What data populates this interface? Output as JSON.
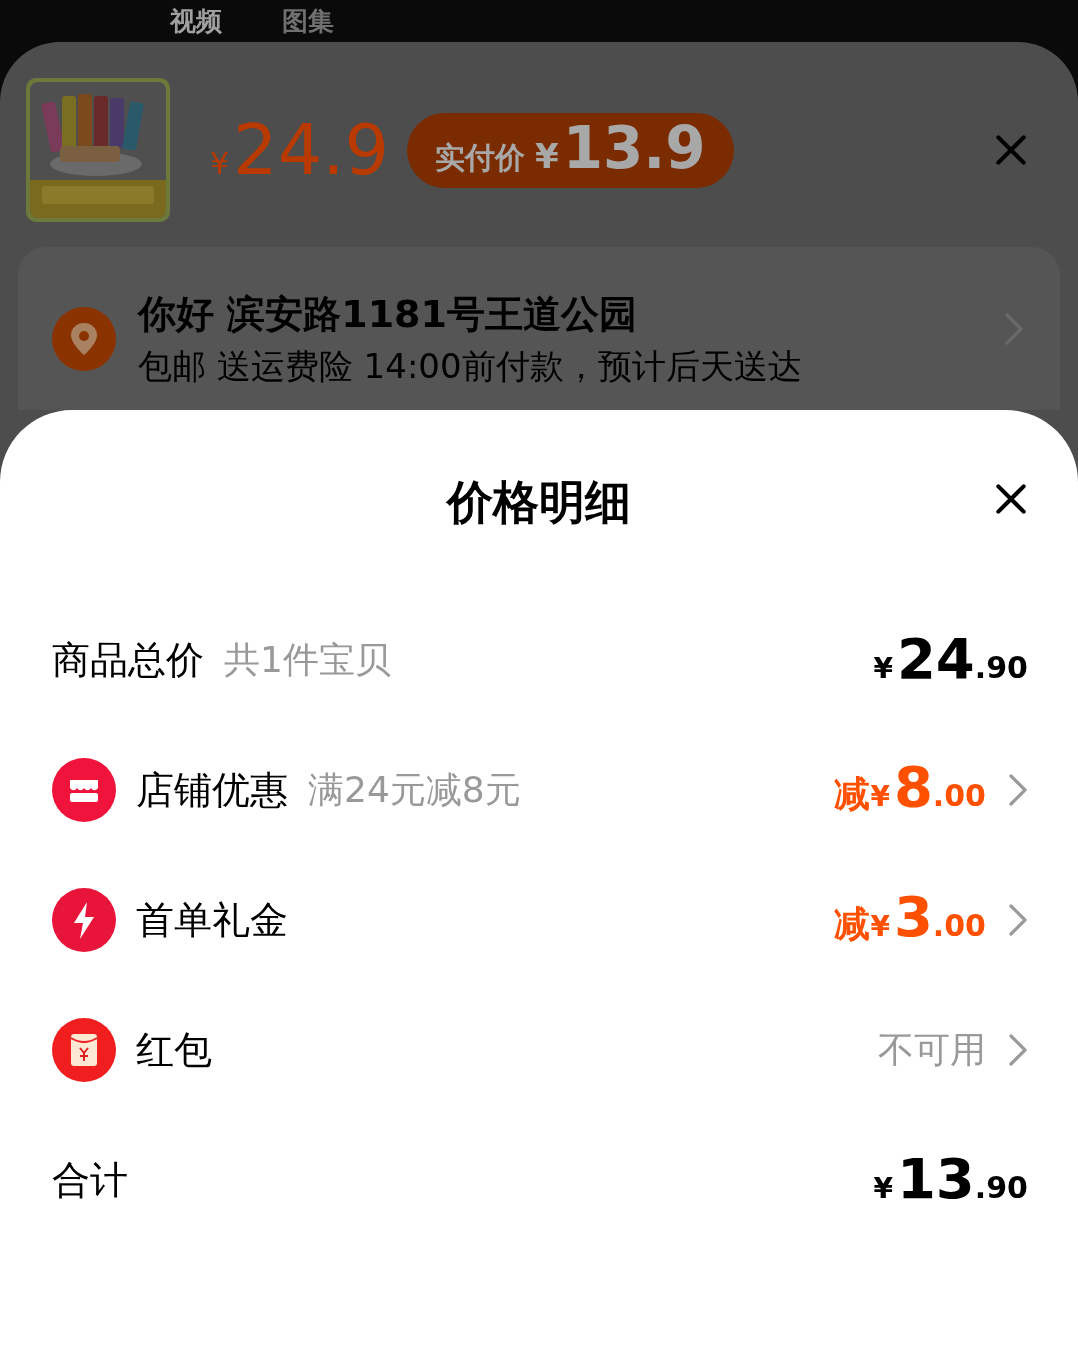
{
  "tabs": [
    {
      "label": "视频",
      "selected": true
    },
    {
      "label": "图集",
      "selected": false
    }
  ],
  "product": {
    "price_symbol": "¥",
    "price": "24.9",
    "badge_label": "实付价",
    "badge_symbol": "¥",
    "badge_price": "13.9"
  },
  "address": {
    "title": "你好 滨安路1181号王道公园",
    "detail": "包邮 送运费险 14:00前付款，预计后天送达"
  },
  "sheet": {
    "title": "价格明细",
    "rows": [
      {
        "kind": "amount",
        "label": "商品总价",
        "note": "共1件宝贝",
        "symbol": "¥",
        "integer": "24",
        "decimal": ".90"
      },
      {
        "kind": "discount",
        "label": "店铺优惠",
        "note": "满24元减8元",
        "prefix": "减",
        "symbol": "¥",
        "integer": "8",
        "decimal": ".00"
      },
      {
        "kind": "discount",
        "label": "首单礼金",
        "prefix": "减",
        "symbol": "¥",
        "integer": "3",
        "decimal": ".00"
      },
      {
        "kind": "status",
        "label": "红包",
        "value": "不可用"
      },
      {
        "kind": "amount",
        "label": "合计",
        "symbol": "¥",
        "integer": "13",
        "decimal": ".90"
      }
    ]
  }
}
